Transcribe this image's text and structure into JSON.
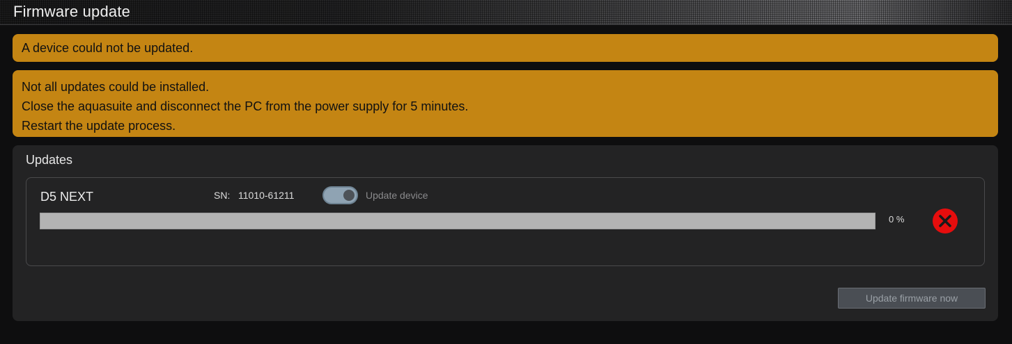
{
  "window": {
    "title": "Firmware update"
  },
  "alerts": [
    {
      "lines": [
        "A device could not be updated."
      ]
    },
    {
      "lines": [
        "Not all updates could be installed.",
        "Close the aquasuite and disconnect the PC from the power supply for 5 minutes.",
        "Restart the update process."
      ]
    }
  ],
  "updates": {
    "section_title": "Updates",
    "device": {
      "name": "D5 NEXT",
      "sn_label": "SN:",
      "sn_value": "11010-61211",
      "toggle_label": "Update device",
      "toggle_on": true,
      "progress_percent": 0,
      "progress_text": "0 %",
      "status_icon": "error-x-icon"
    },
    "update_button_label": "Update firmware now"
  },
  "colors": {
    "alert_bg": "#c48513",
    "error_red": "#e60d0d"
  }
}
